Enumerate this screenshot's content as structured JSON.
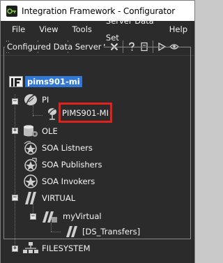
{
  "window": {
    "title": "Integration Framework - Configurator"
  },
  "menu": {
    "items": [
      "File",
      "View",
      "Tools",
      "Server Data Set",
      "Help"
    ]
  },
  "panel": {
    "title": "Configured Data Server"
  },
  "tree": {
    "root": "pims901-mi",
    "pi": "PI",
    "pi_child": "PIMS901-MI",
    "ole": "OLE",
    "soa_listeners": "SOA Listners",
    "soa_publishers": "SOA Publishers",
    "soa_invokers": "SOA Invokers",
    "virtual": "VIRTUAL",
    "my_virtual": "myVirtual",
    "ds_transfers": "[DS_Transfers]",
    "filesystem": "FILESYSTEM"
  },
  "colors": {
    "selection": "#3077d6",
    "highlight": "#e0221c",
    "background": "#2b2b2b"
  }
}
